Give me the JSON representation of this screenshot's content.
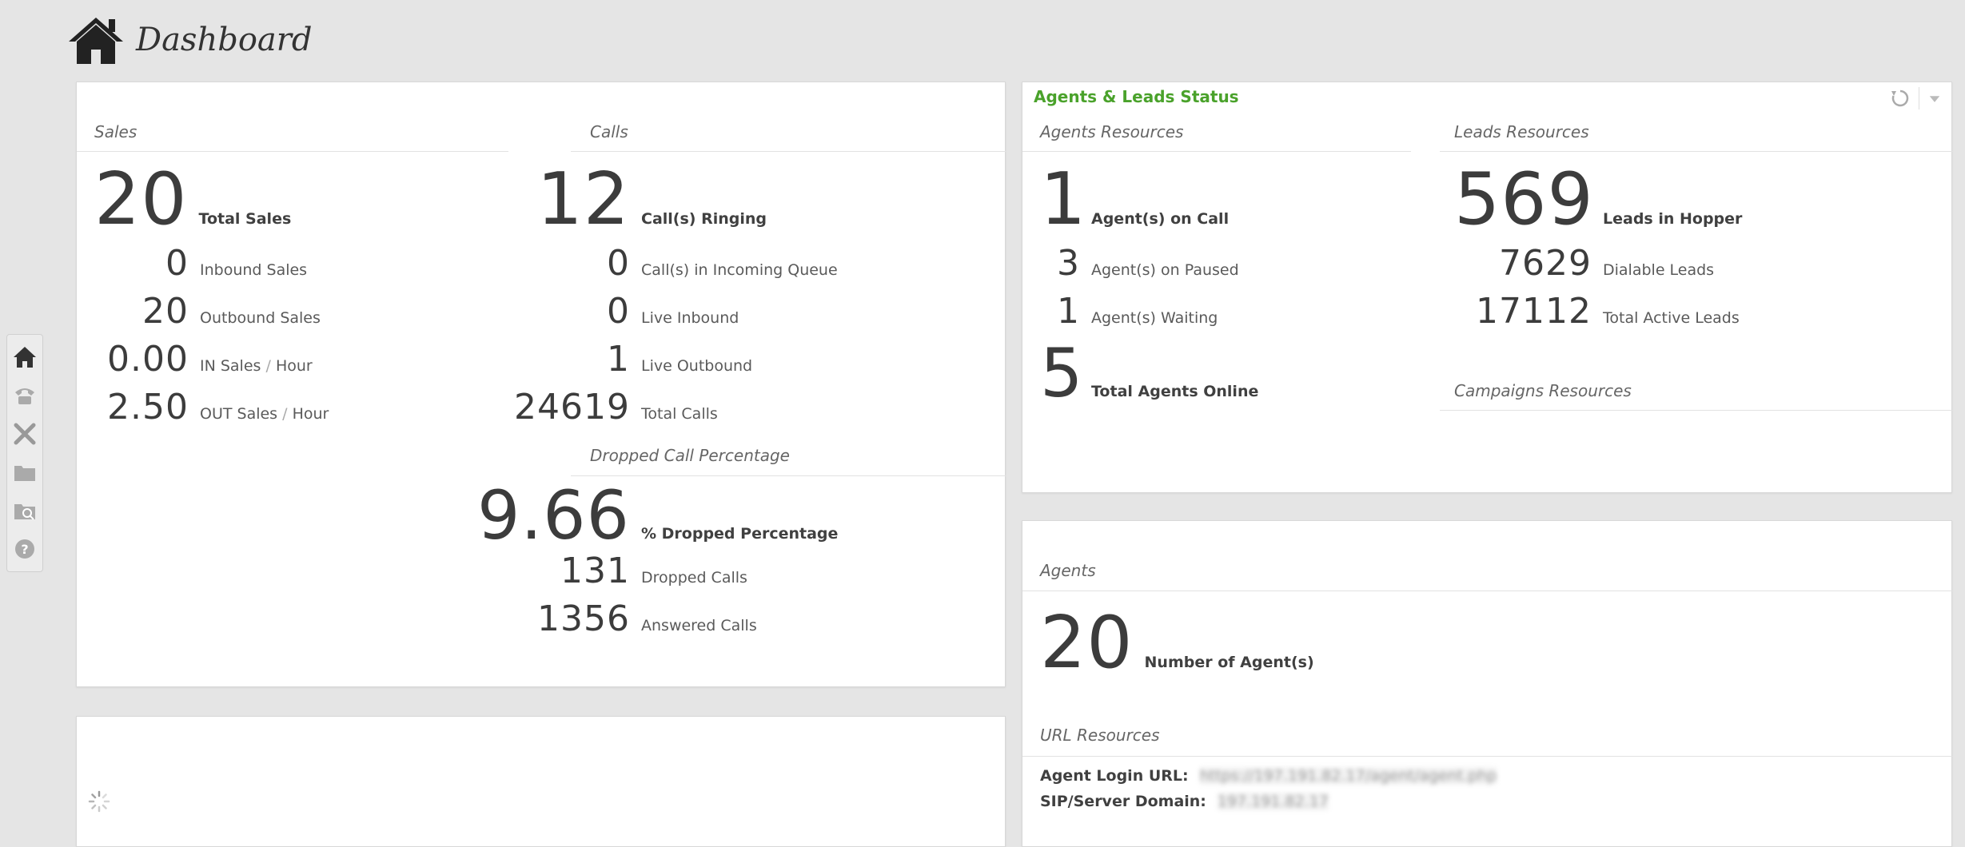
{
  "header": {
    "title": "Dashboard",
    "icon": "home-icon"
  },
  "sidenav": {
    "items": [
      "home-icon",
      "phone-icon",
      "tools-icon",
      "folder-icon",
      "folder-search-icon",
      "help-icon"
    ]
  },
  "sales": {
    "title": "Sales",
    "total": {
      "value": "20",
      "label": "Total Sales"
    },
    "inbound": {
      "value": "0",
      "label": "Inbound Sales"
    },
    "outbound": {
      "value": "20",
      "label": "Outbound Sales"
    },
    "in_per_hour": {
      "value": "0.00",
      "label_a": "IN Sales",
      "sep": "/",
      "label_b": "Hour"
    },
    "out_per_hour": {
      "value": "2.50",
      "label_a": "OUT Sales",
      "sep": "/",
      "label_b": "Hour"
    }
  },
  "calls": {
    "title": "Calls",
    "ringing": {
      "value": "12",
      "label": "Call(s) Ringing"
    },
    "queue": {
      "value": "0",
      "label": "Call(s) in Incoming Queue"
    },
    "live_inbound": {
      "value": "0",
      "label": "Live Inbound"
    },
    "live_outbound": {
      "value": "1",
      "label": "Live Outbound"
    },
    "total": {
      "value": "24619",
      "label": "Total Calls"
    }
  },
  "dropped": {
    "title": "Dropped Call Percentage",
    "percentage": {
      "value": "9.66",
      "label": "% Dropped Percentage"
    },
    "dropped_calls": {
      "value": "131",
      "label": "Dropped Calls"
    },
    "answered": {
      "value": "1356",
      "label": "Answered Calls"
    }
  },
  "status_panel": {
    "title": "Agents & Leads Status",
    "accent": "#4aa22b",
    "agents_resources": {
      "title": "Agents Resources",
      "on_call": {
        "value": "1",
        "label": "Agent(s) on Call"
      },
      "paused": {
        "value": "3",
        "label": "Agent(s) on Paused"
      },
      "waiting": {
        "value": "1",
        "label": "Agent(s) Waiting"
      },
      "online": {
        "value": "5",
        "label": "Total Agents Online"
      }
    },
    "leads_resources": {
      "title": "Leads Resources",
      "hopper": {
        "value": "569",
        "label": "Leads in Hopper"
      },
      "dialable": {
        "value": "7629",
        "label": "Dialable Leads"
      },
      "active": {
        "value": "17112",
        "label": "Total Active Leads"
      }
    },
    "campaigns_resources": {
      "title": "Campaigns Resources"
    }
  },
  "agents_panel": {
    "title": "Agents",
    "count": {
      "value": "20",
      "label": "Number of Agent(s)"
    },
    "url_resources": {
      "title": "URL Resources",
      "login_label": "Agent Login URL:",
      "login_value": "https://197.191.82.17/agent/agent.php",
      "sip_label": "SIP/Server Domain:",
      "sip_value": "197.191.82.17"
    }
  }
}
